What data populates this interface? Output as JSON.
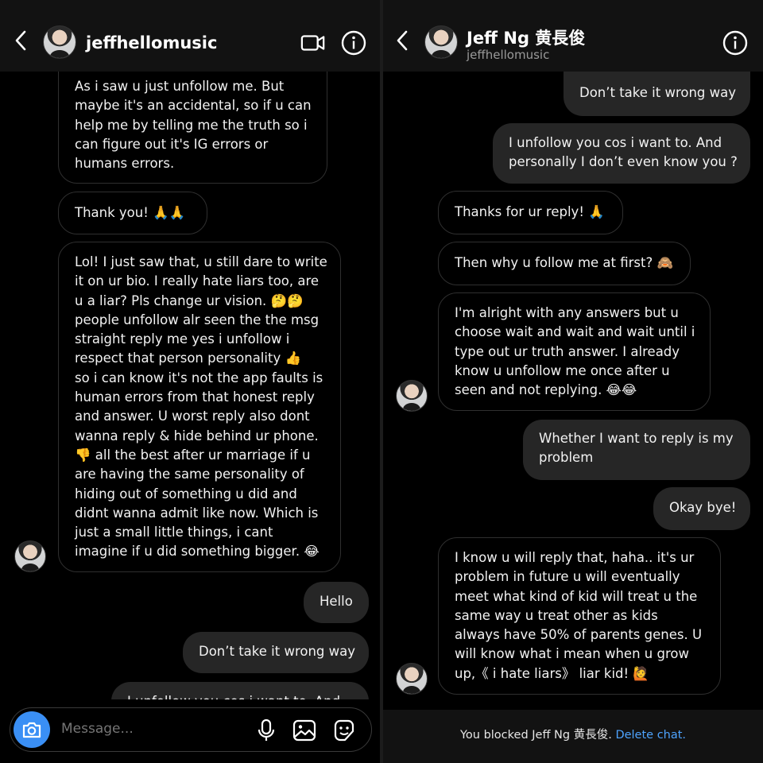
{
  "left": {
    "header": {
      "username": "jeffhellomusic"
    },
    "messages": [
      {
        "dir": "in",
        "text": "As i saw u just unfollow me. But\nmaybe it's an accidental, so if u can\nhelp me by telling me the truth so i\ncan figure out it's IG errors or\nhumans errors."
      },
      {
        "dir": "in",
        "text": "Thank you! 🙏🙏"
      },
      {
        "dir": "in",
        "text": "Lol! I just saw that, u still dare to write\nit on ur bio. I really hate liars too, are\nu a liar? Pls change ur vision. 🤔🤔\npeople unfollow alr seen the the msg\nstraight reply me yes i unfollow i\nrespect that person personality 👍\nso i can know it's not the app faults is\nhuman errors from that honest reply\nand answer. U worst reply also dont\nwanna reply & hide behind ur phone.\n👎 all the best after ur marriage if u\nare having the same personality of\nhiding out of something u did and\ndidnt wanna admit like now. Which is\njust a small little things, i cant\nimagine if u did something bigger. 😂"
      },
      {
        "dir": "out",
        "text": "Hello"
      },
      {
        "dir": "out",
        "text": "Don’t take it wrong way"
      },
      {
        "dir": "out",
        "text": "I unfollow you cos i want to. And"
      }
    ],
    "composer": {
      "placeholder": "Message..."
    }
  },
  "right": {
    "header": {
      "name": "Jeff Ng 黄長俊",
      "username": "jeffhellomusic"
    },
    "messages": [
      {
        "dir": "out",
        "text": "Don’t take it wrong way"
      },
      {
        "dir": "out",
        "text": "I unfollow you cos i want to. And\npersonally I don’t even know you ?"
      },
      {
        "dir": "in",
        "text": "Thanks for ur reply! 🙏"
      },
      {
        "dir": "in",
        "text": "Then why u follow me at first? 🙈"
      },
      {
        "dir": "in",
        "text": "I'm alright with any answers but u\nchoose wait and wait and wait until i\ntype out ur truth answer. I already\nknow u unfollow me once after u\nseen and not replying. 😂😂"
      },
      {
        "dir": "out",
        "text": "Whether I want to reply is my\nproblem"
      },
      {
        "dir": "out",
        "text": "Okay bye!"
      },
      {
        "dir": "in",
        "text": "I know u will reply that, haha.. it's ur\nproblem in future u will eventually\nmeet what kind of kid will treat u the\nsame way u treat other as kids\nalways have 50% of parents genes. U\nwill know what i mean when u grow\nup,《 i hate liars》 liar kid! 🙋"
      }
    ],
    "blocked": {
      "text": "You blocked Jeff Ng 黄長俊.",
      "action": "Delete chat."
    }
  }
}
